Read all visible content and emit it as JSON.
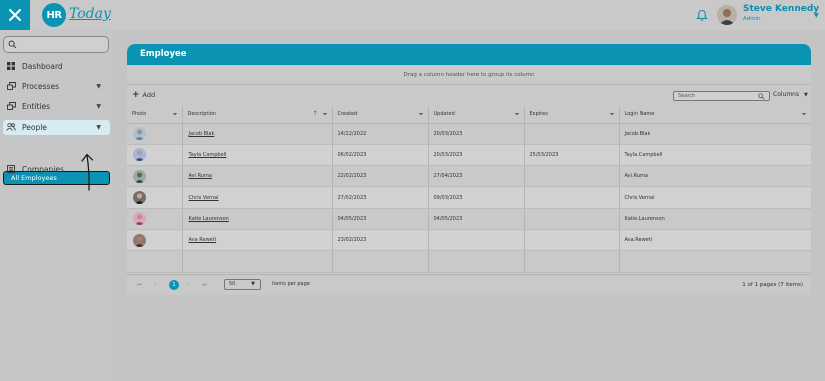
{
  "app": {
    "logo_initials": "HR",
    "logo_text": "Today"
  },
  "user": {
    "name": "Steve Kennedy",
    "role": "Admin"
  },
  "sidebar": {
    "search_placeholder": "",
    "items": [
      {
        "label": "Dashboard",
        "icon": "dashboard-icon"
      },
      {
        "label": "Processes",
        "icon": "processes-icon"
      },
      {
        "label": "Entities",
        "icon": "entities-icon"
      },
      {
        "label": "People",
        "icon": "people-icon"
      },
      {
        "label": "All Employees"
      },
      {
        "label": "Companies",
        "icon": "companies-icon"
      }
    ]
  },
  "panel": {
    "title": "Employee",
    "group_hint": "Drag a column header here to group its column",
    "add_label": "Add",
    "search_placeholder": "Search",
    "columns_label": "Columns"
  },
  "table": {
    "headers": [
      "Photo",
      "Description",
      "Created",
      "Updated",
      "Expires",
      "Login Name"
    ],
    "rows": [
      {
        "photo": "avatar-1",
        "description": "Jacob Blak",
        "created": "14/12/2022",
        "updated": "20/03/2023",
        "expires": "",
        "login": "Jacob.Blak"
      },
      {
        "photo": "avatar-2",
        "description": "Tayla Campbell",
        "created": "06/02/2023",
        "updated": "20/03/2023",
        "expires": "25/03/2023",
        "login": "Tayla.Campbell"
      },
      {
        "photo": "avatar-3",
        "description": "Avi Ruma",
        "created": "22/02/2023",
        "updated": "27/04/2023",
        "expires": "",
        "login": "Avi.Ruma"
      },
      {
        "photo": "avatar-4",
        "description": "Chris Vernal",
        "created": "27/02/2023",
        "updated": "09/03/2023",
        "expires": "",
        "login": "Chris.Vernal"
      },
      {
        "photo": "avatar-5",
        "description": "Katie Laurenson",
        "created": "04/05/2023",
        "updated": "04/05/2023",
        "expires": "",
        "login": "Katie.Laurenson"
      },
      {
        "photo": "avatar-6",
        "description": "Ava Reweti",
        "created": "23/02/2023",
        "updated": "",
        "expires": "",
        "login": "Ava.Reweti"
      }
    ]
  },
  "pager": {
    "current_page": "1",
    "page_size": "50",
    "items_per_page": "items per page",
    "info": "1 of 1 pages (7 items)"
  },
  "colors": {
    "accent": "#0b93b4",
    "background": "#c4c4c4"
  }
}
